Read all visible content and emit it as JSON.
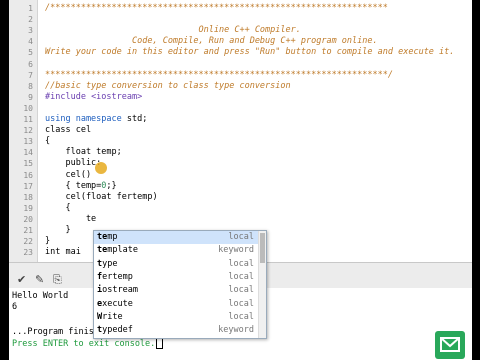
{
  "editor": {
    "lines": [
      {
        "n": "1",
        "segs": [
          {
            "t": "/******************************************************************",
            "c": "comment"
          }
        ]
      },
      {
        "n": "2",
        "segs": [
          {
            "t": "",
            "c": "comment"
          }
        ]
      },
      {
        "n": "3",
        "segs": [
          {
            "t": "                              Online C++ Compiler.",
            "c": "comment"
          }
        ]
      },
      {
        "n": "4",
        "segs": [
          {
            "t": "                 Code, Compile, Run and Debug C++ program online.",
            "c": "comment"
          }
        ]
      },
      {
        "n": "5",
        "segs": [
          {
            "t": "Write your code in this editor and press \"Run\" button to compile and execute it.",
            "c": "comment"
          }
        ]
      },
      {
        "n": "6",
        "segs": [
          {
            "t": "",
            "c": "comment"
          }
        ]
      },
      {
        "n": "7",
        "segs": [
          {
            "t": "*******************************************************************/",
            "c": "comment"
          }
        ]
      },
      {
        "n": "8",
        "segs": [
          {
            "t": "//basic type conversion to class type conversion",
            "c": "comment"
          }
        ]
      },
      {
        "n": "9",
        "segs": [
          {
            "t": "#include ",
            "c": "pre"
          },
          {
            "t": "<iostream>",
            "c": "pre"
          }
        ]
      },
      {
        "n": "10",
        "segs": [
          {
            "t": "",
            "c": ""
          }
        ]
      },
      {
        "n": "11",
        "segs": [
          {
            "t": "using namespace",
            "c": "kw"
          },
          {
            "t": " std;",
            "c": ""
          }
        ]
      },
      {
        "n": "12",
        "segs": [
          {
            "t": "class cel",
            "c": ""
          }
        ]
      },
      {
        "n": "13",
        "segs": [
          {
            "t": "{",
            "c": ""
          }
        ]
      },
      {
        "n": "14",
        "segs": [
          {
            "t": "    float temp;",
            "c": ""
          }
        ]
      },
      {
        "n": "15",
        "segs": [
          {
            "t": "    public:",
            "c": ""
          }
        ]
      },
      {
        "n": "16",
        "segs": [
          {
            "t": "    cel()",
            "c": ""
          }
        ]
      },
      {
        "n": "17",
        "segs": [
          {
            "t": "    { temp=",
            "c": ""
          },
          {
            "t": "0",
            "c": "num"
          },
          {
            "t": ";}",
            "c": ""
          }
        ]
      },
      {
        "n": "18",
        "segs": [
          {
            "t": "    cel(float fertemp)",
            "c": ""
          }
        ]
      },
      {
        "n": "19",
        "segs": [
          {
            "t": "    {",
            "c": ""
          }
        ]
      },
      {
        "n": "20",
        "segs": [
          {
            "t": "        te",
            "c": ""
          }
        ]
      },
      {
        "n": "21",
        "segs": [
          {
            "t": "    }",
            "c": ""
          }
        ]
      },
      {
        "n": "22",
        "segs": [
          {
            "t": "}",
            "c": ""
          }
        ]
      },
      {
        "n": "23",
        "segs": [
          {
            "t": "int mai",
            "c": ""
          }
        ]
      }
    ]
  },
  "autocomplete": {
    "items": [
      {
        "match": "te",
        "rest": "mp",
        "type": "local"
      },
      {
        "match": "te",
        "rest": "mplate",
        "type": "keyword"
      },
      {
        "match": "t",
        "rest": "ype",
        "type": "local"
      },
      {
        "match": "f",
        "rest": "ertemp",
        "type": "local"
      },
      {
        "match": "i",
        "rest": "ostream",
        "type": "local"
      },
      {
        "match": "e",
        "rest": "xecute",
        "type": "local"
      },
      {
        "match": "W",
        "rest": "rite",
        "type": "local"
      },
      {
        "match": "t",
        "rest": "ypedef",
        "type": "keyword"
      }
    ]
  },
  "toolbar": {
    "collapse_icon": "chevron-down-icon",
    "edit_icon": "pencil-icon",
    "copy_icon": "copy-icon"
  },
  "console": {
    "out1": "Hello World",
    "out2": "6",
    "finish": "...Program finished with exit code 0",
    "prompt": "Press ENTER to exit console."
  },
  "colors": {
    "comment": "#bf7b2a",
    "keyword": "#1f5fbf",
    "console_green": "#1e9a3c",
    "feedback_button": "#29a85a"
  }
}
